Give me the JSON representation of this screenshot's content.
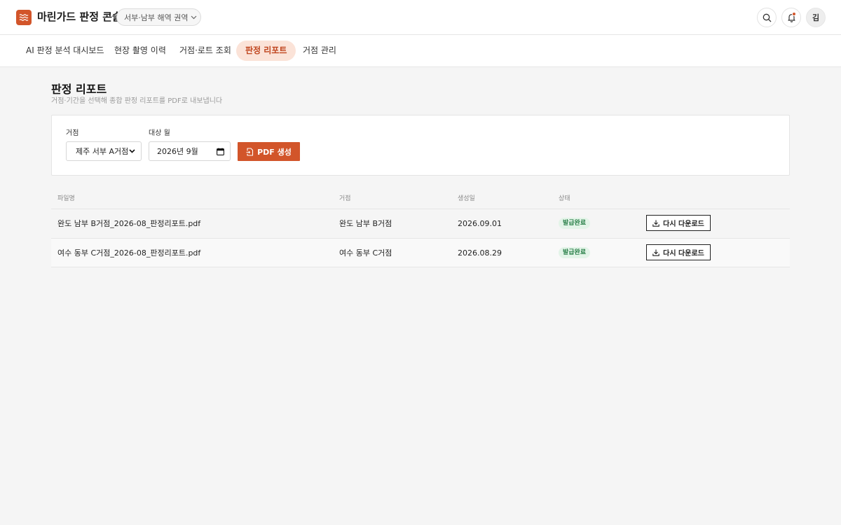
{
  "app": {
    "title": "마린가드 판정 콘솔"
  },
  "header": {
    "region_label": "서부·남부 해역 권역",
    "avatar_initial": "김"
  },
  "tabs": [
    {
      "label": "AI 판정 분석 대시보드"
    },
    {
      "label": "현장 촬영 이력"
    },
    {
      "label": "거점·로트 조회"
    },
    {
      "label": "판정 리포트",
      "active": true
    },
    {
      "label": "거점 관리"
    }
  ],
  "page": {
    "title": "판정 리포트",
    "subtitle": "거점·기간을 선택해 종합 판정 리포트를 PDF로 내보냅니다"
  },
  "filters": {
    "site_label": "거점",
    "site_value": "제주 서부 A거점",
    "month_label": "대상 월",
    "month_value": "2026년 9월",
    "generate_label": "PDF 생성"
  },
  "table": {
    "headers": {
      "file": "파일명",
      "site": "거점",
      "date": "생성일",
      "status": "상태"
    },
    "rows": [
      {
        "file": "완도 남부 B거점_2026-08_판정리포트.pdf",
        "site": "완도 남부 B거점",
        "date": "2026.09.01",
        "status": "발급완료",
        "action": "다시 다운로드"
      },
      {
        "file": "여수 동부 C거점_2026-08_판정리포트.pdf",
        "site": "여수 동부 C거점",
        "date": "2026.08.29",
        "status": "발급완료",
        "action": "다시 다운로드"
      }
    ]
  },
  "colors": {
    "accent": "#d2552a",
    "accent_soft": "#fbe3d8",
    "success": "#2a8049",
    "success_bg": "#e3f4e8"
  }
}
